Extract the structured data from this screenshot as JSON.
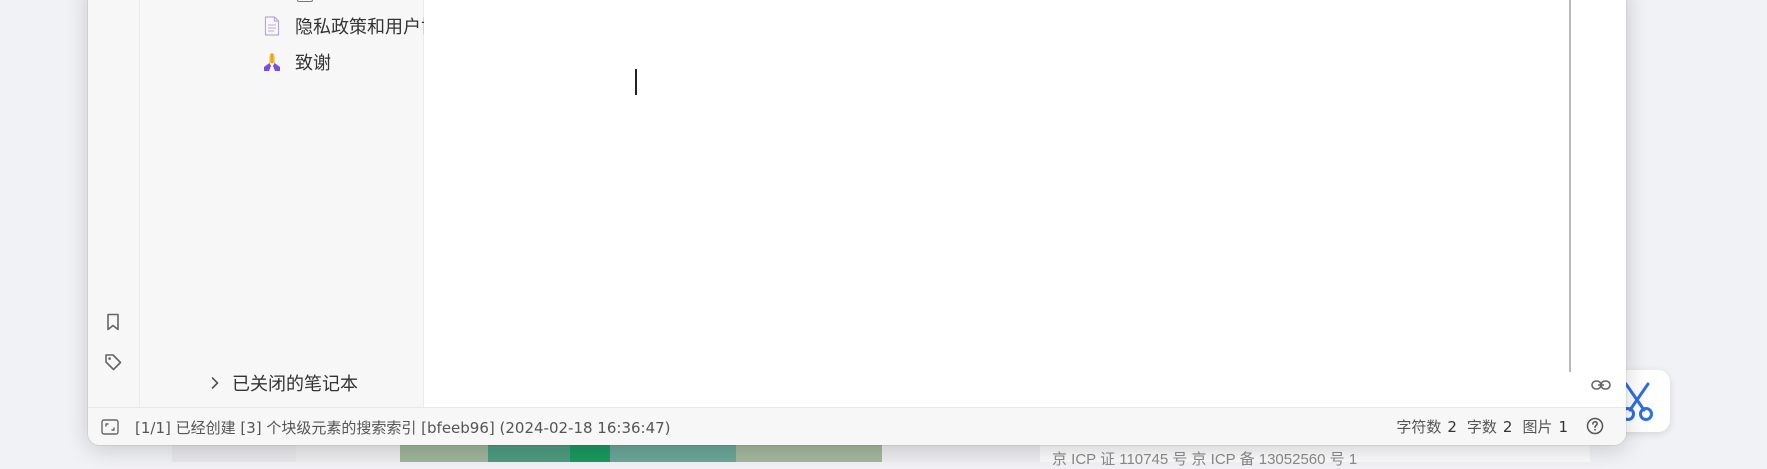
{
  "filetree": {
    "items": [
      {
        "label": "隐私政策和用户协议",
        "icon": "document-icon"
      },
      {
        "label": "致谢",
        "icon": "praying-hands-icon"
      }
    ],
    "closed_notebooks_label": "已关闭的笔记本"
  },
  "statusbar": {
    "message": "[1/1] 已经创建 [3] 个块级元素的搜索索引 [bfeeb96] (2024-02-18 16:36:47)",
    "char_count_label": "字符数",
    "char_count": "2",
    "word_count_label": "字数",
    "word_count": "2",
    "image_count_label": "图片",
    "image_count": "1"
  },
  "background": {
    "footer_text": "京 ICP 证 110745 号   京 ICP 备 13052560 号   1"
  },
  "colors": {
    "accent_purple": "#7b4ee0",
    "scissor_blue": "#2f6fe0"
  }
}
